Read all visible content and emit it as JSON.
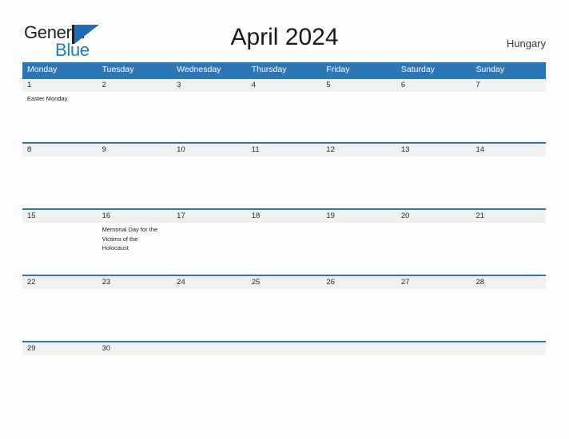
{
  "brand": {
    "word_one": "General",
    "word_two": "Blue",
    "mark_icon": "flag-icon",
    "accent_color": "#1f7ac4"
  },
  "header": {
    "title": "April 2024",
    "country": "Hungary"
  },
  "calendar": {
    "header_background": "#2e75b6",
    "date_band_background": "#f0f0f0",
    "weekdays": [
      "Monday",
      "Tuesday",
      "Wednesday",
      "Thursday",
      "Friday",
      "Saturday",
      "Sunday"
    ],
    "weeks": [
      {
        "days": [
          {
            "date": "1",
            "event": "Easter Monday"
          },
          {
            "date": "2",
            "event": ""
          },
          {
            "date": "3",
            "event": ""
          },
          {
            "date": "4",
            "event": ""
          },
          {
            "date": "5",
            "event": ""
          },
          {
            "date": "6",
            "event": ""
          },
          {
            "date": "7",
            "event": ""
          }
        ]
      },
      {
        "days": [
          {
            "date": "8",
            "event": ""
          },
          {
            "date": "9",
            "event": ""
          },
          {
            "date": "10",
            "event": ""
          },
          {
            "date": "11",
            "event": ""
          },
          {
            "date": "12",
            "event": ""
          },
          {
            "date": "13",
            "event": ""
          },
          {
            "date": "14",
            "event": ""
          }
        ]
      },
      {
        "days": [
          {
            "date": "15",
            "event": ""
          },
          {
            "date": "16",
            "event": "Memorial Day for the Victims of the Holocaust"
          },
          {
            "date": "17",
            "event": ""
          },
          {
            "date": "18",
            "event": ""
          },
          {
            "date": "19",
            "event": ""
          },
          {
            "date": "20",
            "event": ""
          },
          {
            "date": "21",
            "event": ""
          }
        ]
      },
      {
        "days": [
          {
            "date": "22",
            "event": ""
          },
          {
            "date": "23",
            "event": ""
          },
          {
            "date": "24",
            "event": ""
          },
          {
            "date": "25",
            "event": ""
          },
          {
            "date": "26",
            "event": ""
          },
          {
            "date": "27",
            "event": ""
          },
          {
            "date": "28",
            "event": ""
          }
        ]
      },
      {
        "days": [
          {
            "date": "29",
            "event": ""
          },
          {
            "date": "30",
            "event": ""
          },
          {
            "date": "",
            "event": ""
          },
          {
            "date": "",
            "event": ""
          },
          {
            "date": "",
            "event": ""
          },
          {
            "date": "",
            "event": ""
          },
          {
            "date": "",
            "event": ""
          }
        ]
      }
    ]
  }
}
